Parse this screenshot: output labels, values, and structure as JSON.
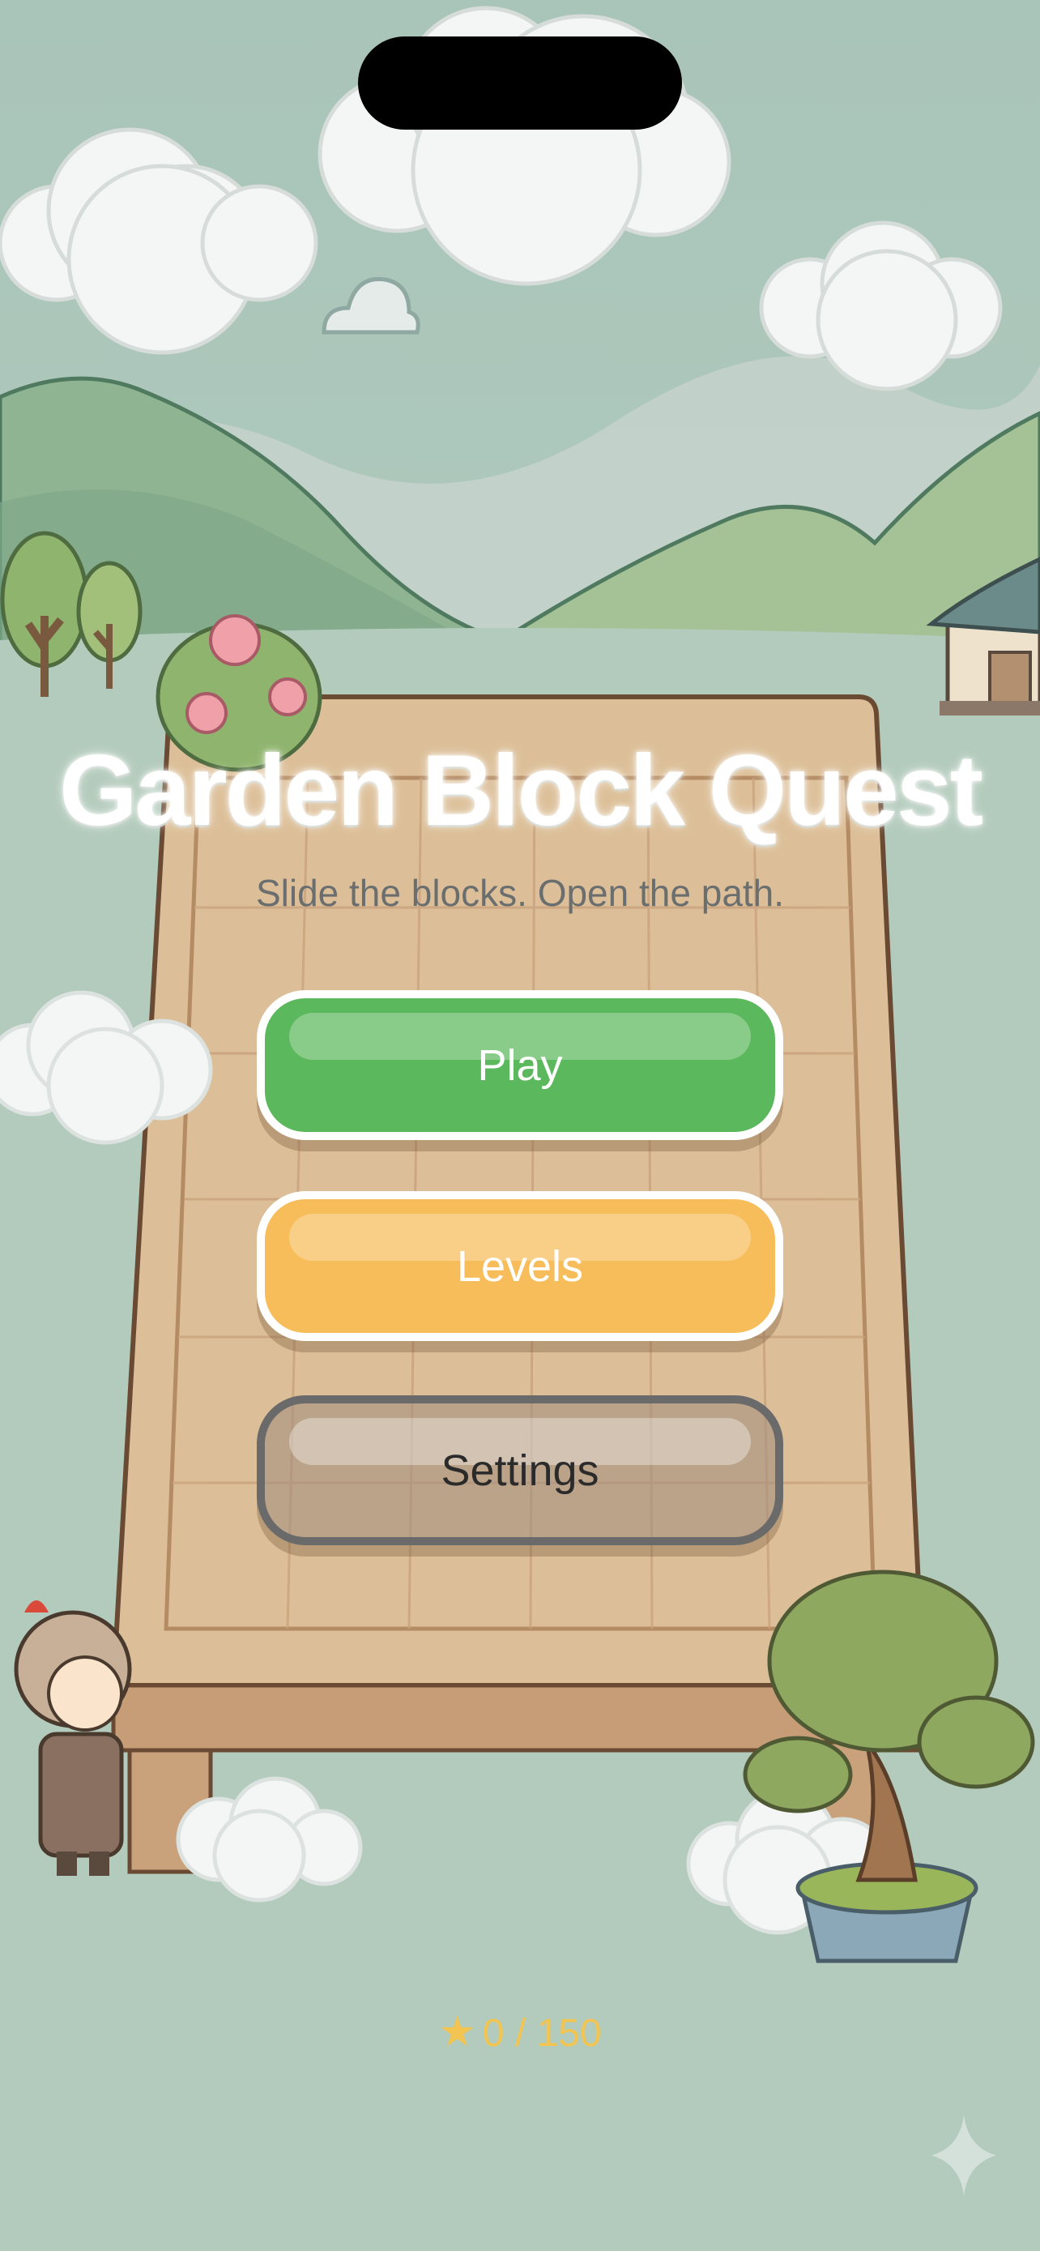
{
  "game": {
    "title": "Garden Block Quest",
    "tagline": "Slide the blocks. Open the path."
  },
  "menu": {
    "play_label": "Play",
    "levels_label": "Levels",
    "settings_label": "Settings"
  },
  "progress": {
    "star_icon": "star-icon",
    "stars_text": "0 / 150"
  },
  "colors": {
    "play": "#5cb85c",
    "levels": "#f7bd5a",
    "settings": "#a08c7d",
    "star": "#f2c451"
  }
}
